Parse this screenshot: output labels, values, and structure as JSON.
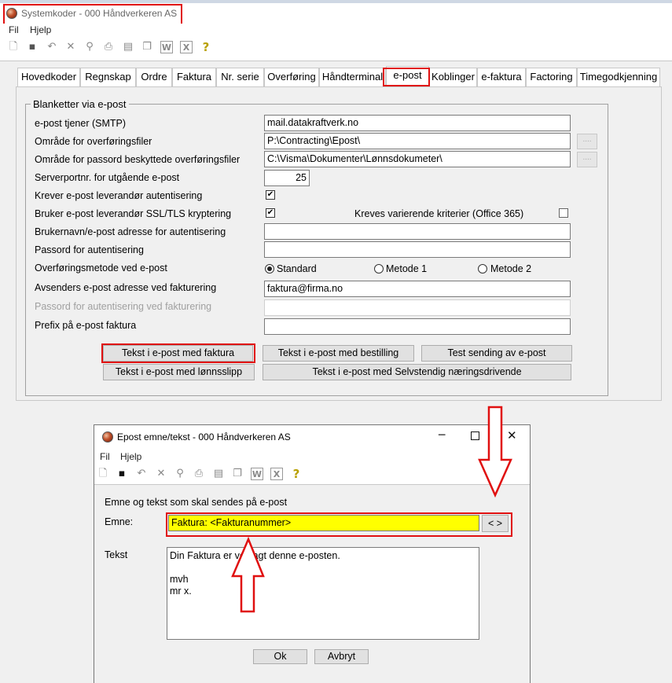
{
  "main_window": {
    "title": "Systemkoder - 000 Håndverkeren AS",
    "menu": [
      "Fil",
      "Hjelp"
    ],
    "toolbar_icons": [
      "new-icon",
      "save-icon",
      "undo-icon",
      "delete-icon",
      "search-icon",
      "print-icon",
      "table-icon",
      "copy-icon",
      "word-icon",
      "excel-icon",
      "help-icon"
    ]
  },
  "tabs": [
    "Hovedkoder",
    "Regnskap",
    "Ordre",
    "Faktura",
    "Nr. serie",
    "Overføring",
    "Håndterminal",
    "e-post",
    "Koblinger",
    "e-faktura",
    "Factoring",
    "Timegodkjenning"
  ],
  "active_tab": "e-post",
  "group": {
    "legend": "Blanketter via e-post",
    "fields": {
      "smtp_label": "e-post tjener (SMTP)",
      "smtp_value": "mail.datakraftverk.no",
      "transfer_area_label": "Område for overføringsfiler",
      "transfer_area_value": "P:\\Contracting\\Epost\\",
      "protected_area_label": "Område for passord beskyttede overføringsfiler",
      "protected_area_value": "C:\\Visma\\Dokumenter\\Lønnsdokumeter\\",
      "browse_label": "....",
      "port_label": "Serverportnr. for utgående e-post",
      "port_value": "25",
      "auth_label": "Krever e-post leverandør autentisering",
      "ssl_label": "Bruker e-post leverandør SSL/TLS kryptering",
      "office365_label": "Kreves varierende kriterier (Office 365)",
      "username_label": "Brukernavn/e-post adresse for autentisering",
      "username_value": "",
      "password_label": "Passord for autentisering",
      "password_value": "",
      "method_label": "Overføringsmetode ved e-post",
      "method_options": [
        "Standard",
        "Metode 1",
        "Metode 2"
      ],
      "sender_label": "Avsenders e-post adresse ved fakturering",
      "sender_value": "faktura@firma.no",
      "invoice_password_label": "Passord for autentisering ved fakturering",
      "invoice_password_value": "",
      "prefix_label": "Prefix på e-post faktura",
      "prefix_value": ""
    },
    "checkboxes": {
      "auth": true,
      "ssl": true,
      "office365": false
    },
    "selected_method": "Standard",
    "buttons": {
      "invoice_text": "Tekst i e-post med faktura",
      "order_text": "Tekst i e-post med bestilling",
      "test_send": "Test sending av e-post",
      "payslip_text": "Tekst i e-post med lønnsslipp",
      "selfemployed_text": "Tekst i e-post med Selvstendig næringsdrivende"
    }
  },
  "dialog": {
    "title": "Epost emne/tekst - 000 Håndverkeren AS",
    "menu": [
      "Fil",
      "Hjelp"
    ],
    "heading": "Emne og tekst som skal sendes på e-post",
    "subject_label": "Emne:",
    "subject_value": "Faktura: <Fakturanummer>",
    "subject_button": "< >",
    "text_label": "Tekst",
    "body_lines": [
      "Din Faktura er vedlagt denne e-posten.",
      "",
      "mvh",
      "mr x."
    ],
    "ok": "Ok",
    "cancel": "Avbryt"
  },
  "colors": {
    "highlight": "#ffff00",
    "annotation_red": "#e01010"
  }
}
